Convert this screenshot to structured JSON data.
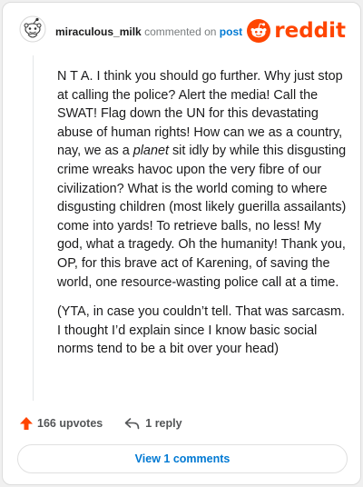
{
  "header": {
    "username": "miraculous_milk",
    "commented_on": "commented on",
    "post_link": "post",
    "logo_text": "reddit",
    "logo_icon": "reddit-alien-icon",
    "avatar_icon": "snoo-avatar-icon"
  },
  "comment": {
    "paragraph_1_before": "N T A. I think you should go further. Why just stop at calling the police? Alert the media! Call the SWAT! Flag down the UN for this devastating abuse of human rights! How can we as a country, nay, we as a ",
    "paragraph_1_italic": "planet",
    "paragraph_1_after": " sit idly by while this disgusting crime wreaks havoc upon the very fibre of our civilization? What is the world coming to where disgusting children (most likely guerilla assailants) come into yards! To retrieve balls, no less! My god, what a tragedy. Oh the humanity! Thank you, OP, for this brave act of Karening, of saving the world, one resource-wasting police call at a time.",
    "paragraph_2": "(YTA, in case you couldn’t tell. That was sarcasm. I thought I’d explain since I know basic social norms tend to be a bit over your head)"
  },
  "actions": {
    "upvotes_label": "166 upvotes",
    "upvote_icon": "upvote-arrow-icon",
    "reply_label": "1 reply",
    "reply_icon": "reply-arrow-icon"
  },
  "view_comments_label": "View 1 comments",
  "colors": {
    "brand_orange": "#ff4500",
    "link_blue": "#0079d3",
    "muted_gray": "#787c7e"
  }
}
